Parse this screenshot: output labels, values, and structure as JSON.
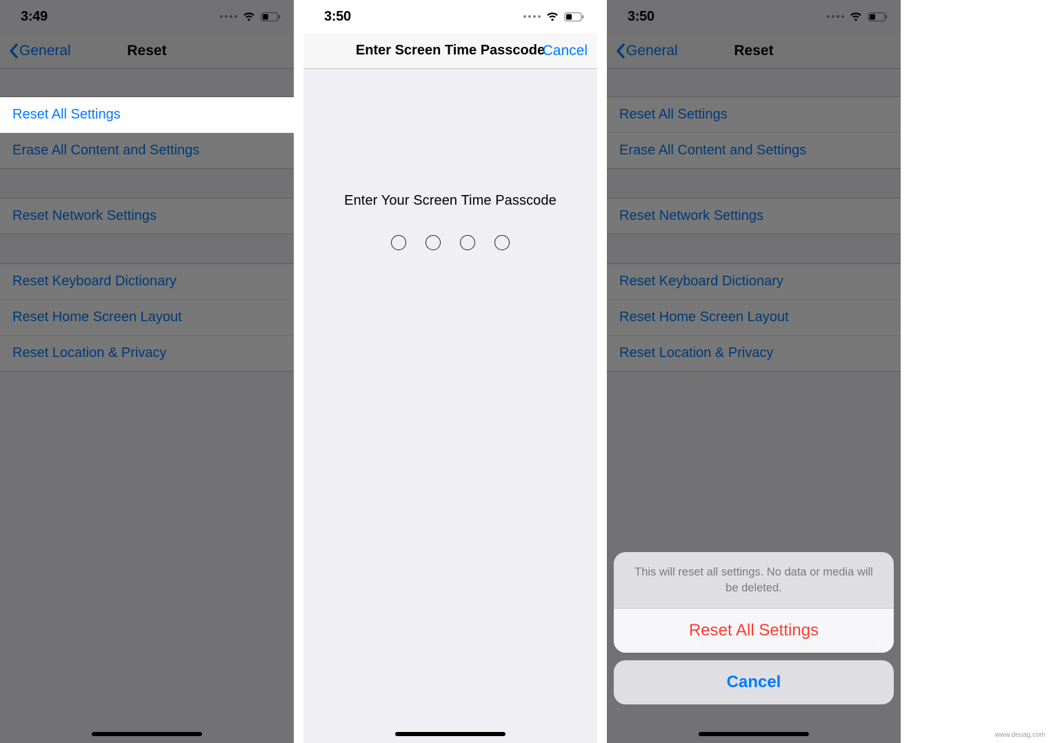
{
  "phone1": {
    "time": "3:49",
    "back_label": "General",
    "title": "Reset",
    "groups": [
      {
        "cells": [
          "Reset All Settings",
          "Erase All Content and Settings"
        ]
      },
      {
        "cells": [
          "Reset Network Settings"
        ]
      },
      {
        "cells": [
          "Reset Keyboard Dictionary",
          "Reset Home Screen Layout",
          "Reset Location & Privacy"
        ]
      }
    ],
    "highlighted_cell": "Reset All Settings"
  },
  "phone2": {
    "time": "3:50",
    "title": "Enter Screen Time Passcode",
    "cancel": "Cancel",
    "prompt": "Enter Your Screen Time Passcode",
    "digits": 4
  },
  "phone3": {
    "time": "3:50",
    "back_label": "General",
    "title": "Reset",
    "groups": [
      {
        "cells": [
          "Reset All Settings",
          "Erase All Content and Settings"
        ]
      },
      {
        "cells": [
          "Reset Network Settings"
        ]
      },
      {
        "cells": [
          "Reset Keyboard Dictionary",
          "Reset Home Screen Layout",
          "Reset Location & Privacy"
        ]
      }
    ],
    "sheet": {
      "message": "This will reset all settings. No data or media will be deleted.",
      "confirm": "Reset All Settings",
      "cancel": "Cancel"
    }
  },
  "watermark": "www.deuag.com"
}
